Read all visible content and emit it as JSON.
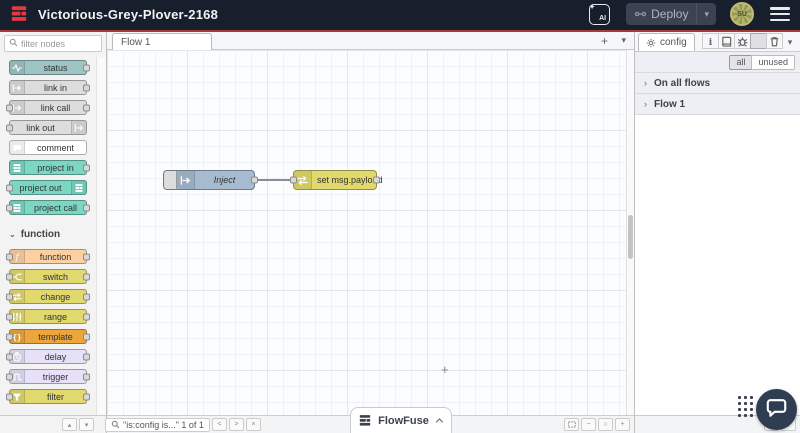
{
  "header": {
    "title": "Victorious-Grey-Plover-2168",
    "ai_label": "AI",
    "deploy_label": "Deploy",
    "deploy_caret": "▾",
    "avatar_initials": "SU"
  },
  "palette": {
    "search_placeholder": "filter nodes",
    "footer_buttons": [
      "▴",
      "▾"
    ],
    "sections": [
      {
        "label": null,
        "nodes": [
          {
            "label": "status",
            "icon": "pulse",
            "color": "#9fc4c4",
            "in": false,
            "out": true,
            "icon_side": "left"
          },
          {
            "label": "link in",
            "icon": "link",
            "color": "#dddddd",
            "in": false,
            "out": true,
            "icon_side": "left"
          },
          {
            "label": "link call",
            "icon": "link",
            "color": "#dddddd",
            "in": true,
            "out": true,
            "icon_side": "left"
          },
          {
            "label": "link out",
            "icon": "link",
            "color": "#dddddd",
            "in": true,
            "out": false,
            "icon_side": "right"
          },
          {
            "label": "comment",
            "icon": "comment",
            "color": "#ffffff",
            "in": false,
            "out": false,
            "icon_side": "left"
          },
          {
            "label": "project in",
            "icon": "ff",
            "color": "#7bd6c4",
            "in": false,
            "out": true,
            "icon_side": "left"
          },
          {
            "label": "project out",
            "icon": "ff",
            "color": "#7bd6c4",
            "in": true,
            "out": false,
            "icon_side": "right"
          },
          {
            "label": "project call",
            "icon": "ff",
            "color": "#7bd6c4",
            "in": true,
            "out": true,
            "icon_side": "left"
          }
        ]
      },
      {
        "label": "function",
        "collapse_glyph": "⌄",
        "nodes": [
          {
            "label": "function",
            "icon": "function",
            "color": "#fdd0a2",
            "in": true,
            "out": true,
            "icon_side": "left"
          },
          {
            "label": "switch",
            "icon": "switch",
            "color": "#e2d96e",
            "in": true,
            "out": true,
            "icon_side": "left"
          },
          {
            "label": "change",
            "icon": "change",
            "color": "#e2d96e",
            "in": true,
            "out": true,
            "icon_side": "left"
          },
          {
            "label": "range",
            "icon": "range",
            "color": "#e2d96e",
            "in": true,
            "out": true,
            "icon_side": "left"
          },
          {
            "label": "template",
            "icon": "template",
            "color": "#eba63d",
            "in": true,
            "out": true,
            "icon_side": "left"
          },
          {
            "label": "delay",
            "icon": "delay",
            "color": "#e6e0f8",
            "in": true,
            "out": true,
            "icon_side": "left"
          },
          {
            "label": "trigger",
            "icon": "trigger",
            "color": "#e6e0f8",
            "in": true,
            "out": true,
            "icon_side": "left"
          },
          {
            "label": "filter",
            "icon": "filter",
            "color": "#e2d96e",
            "in": true,
            "out": true,
            "icon_side": "left"
          }
        ]
      }
    ]
  },
  "canvas": {
    "tab_label": "Flow 1",
    "add_tab_glyph": "+",
    "tab_list_glyph": "▾",
    "nodes": [
      {
        "label": "Inject",
        "type": "inject",
        "color": "#a6bbcf"
      },
      {
        "label": "set msg.payload",
        "type": "change",
        "color": "#e2d96e"
      }
    ],
    "wire_color": "#888d96",
    "cursor_glyph": "+"
  },
  "canvas_footer": {
    "search_text": "\"is:config is...\" 1 of 1",
    "prev_glyph": "<",
    "next_glyph": ">",
    "close_glyph": "×",
    "zoom_out_glyph": "−",
    "zoom_reset_glyph": "○",
    "zoom_in_glyph": "+"
  },
  "flowfuse": {
    "label": "FlowFuse"
  },
  "sidebar": {
    "tab_label": "config",
    "toolbar_icons": [
      "info",
      "book",
      "bug",
      "gear",
      "trash"
    ],
    "active_toolbar_icon": "gear",
    "caret_glyph": "▾",
    "filter_buttons": [
      "all",
      "unused"
    ],
    "active_filter": "all",
    "group_chevron": "›",
    "groups": [
      "On all flows",
      "Flow 1"
    ],
    "footer_buttons": [
      "▴",
      "▾"
    ]
  },
  "colors": {
    "header_bg": "#171e2c",
    "header_accent": "#a83a36",
    "logo_red": "#e4383f",
    "canvas_bg": "#fbfcfe",
    "palette_bg": "#f3f3f3",
    "project_teal": "#7bd6c4",
    "chat_bg": "#2f3d52"
  }
}
